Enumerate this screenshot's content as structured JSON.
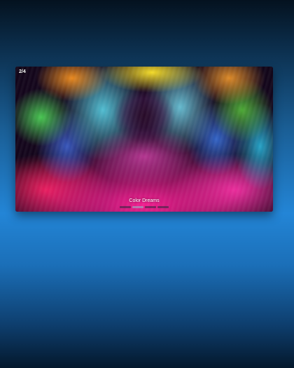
{
  "slideshow": {
    "counter": "2/4",
    "caption": "Color Dreams",
    "slide_count": 4,
    "active_index": 1,
    "indicators": [
      {
        "active": false
      },
      {
        "active": true
      },
      {
        "active": false
      },
      {
        "active": false
      }
    ]
  },
  "colors": {
    "background_top": "#04121f",
    "background_mid": "#2385d6",
    "background_bottom": "#04182c",
    "text": "#ffffff"
  }
}
